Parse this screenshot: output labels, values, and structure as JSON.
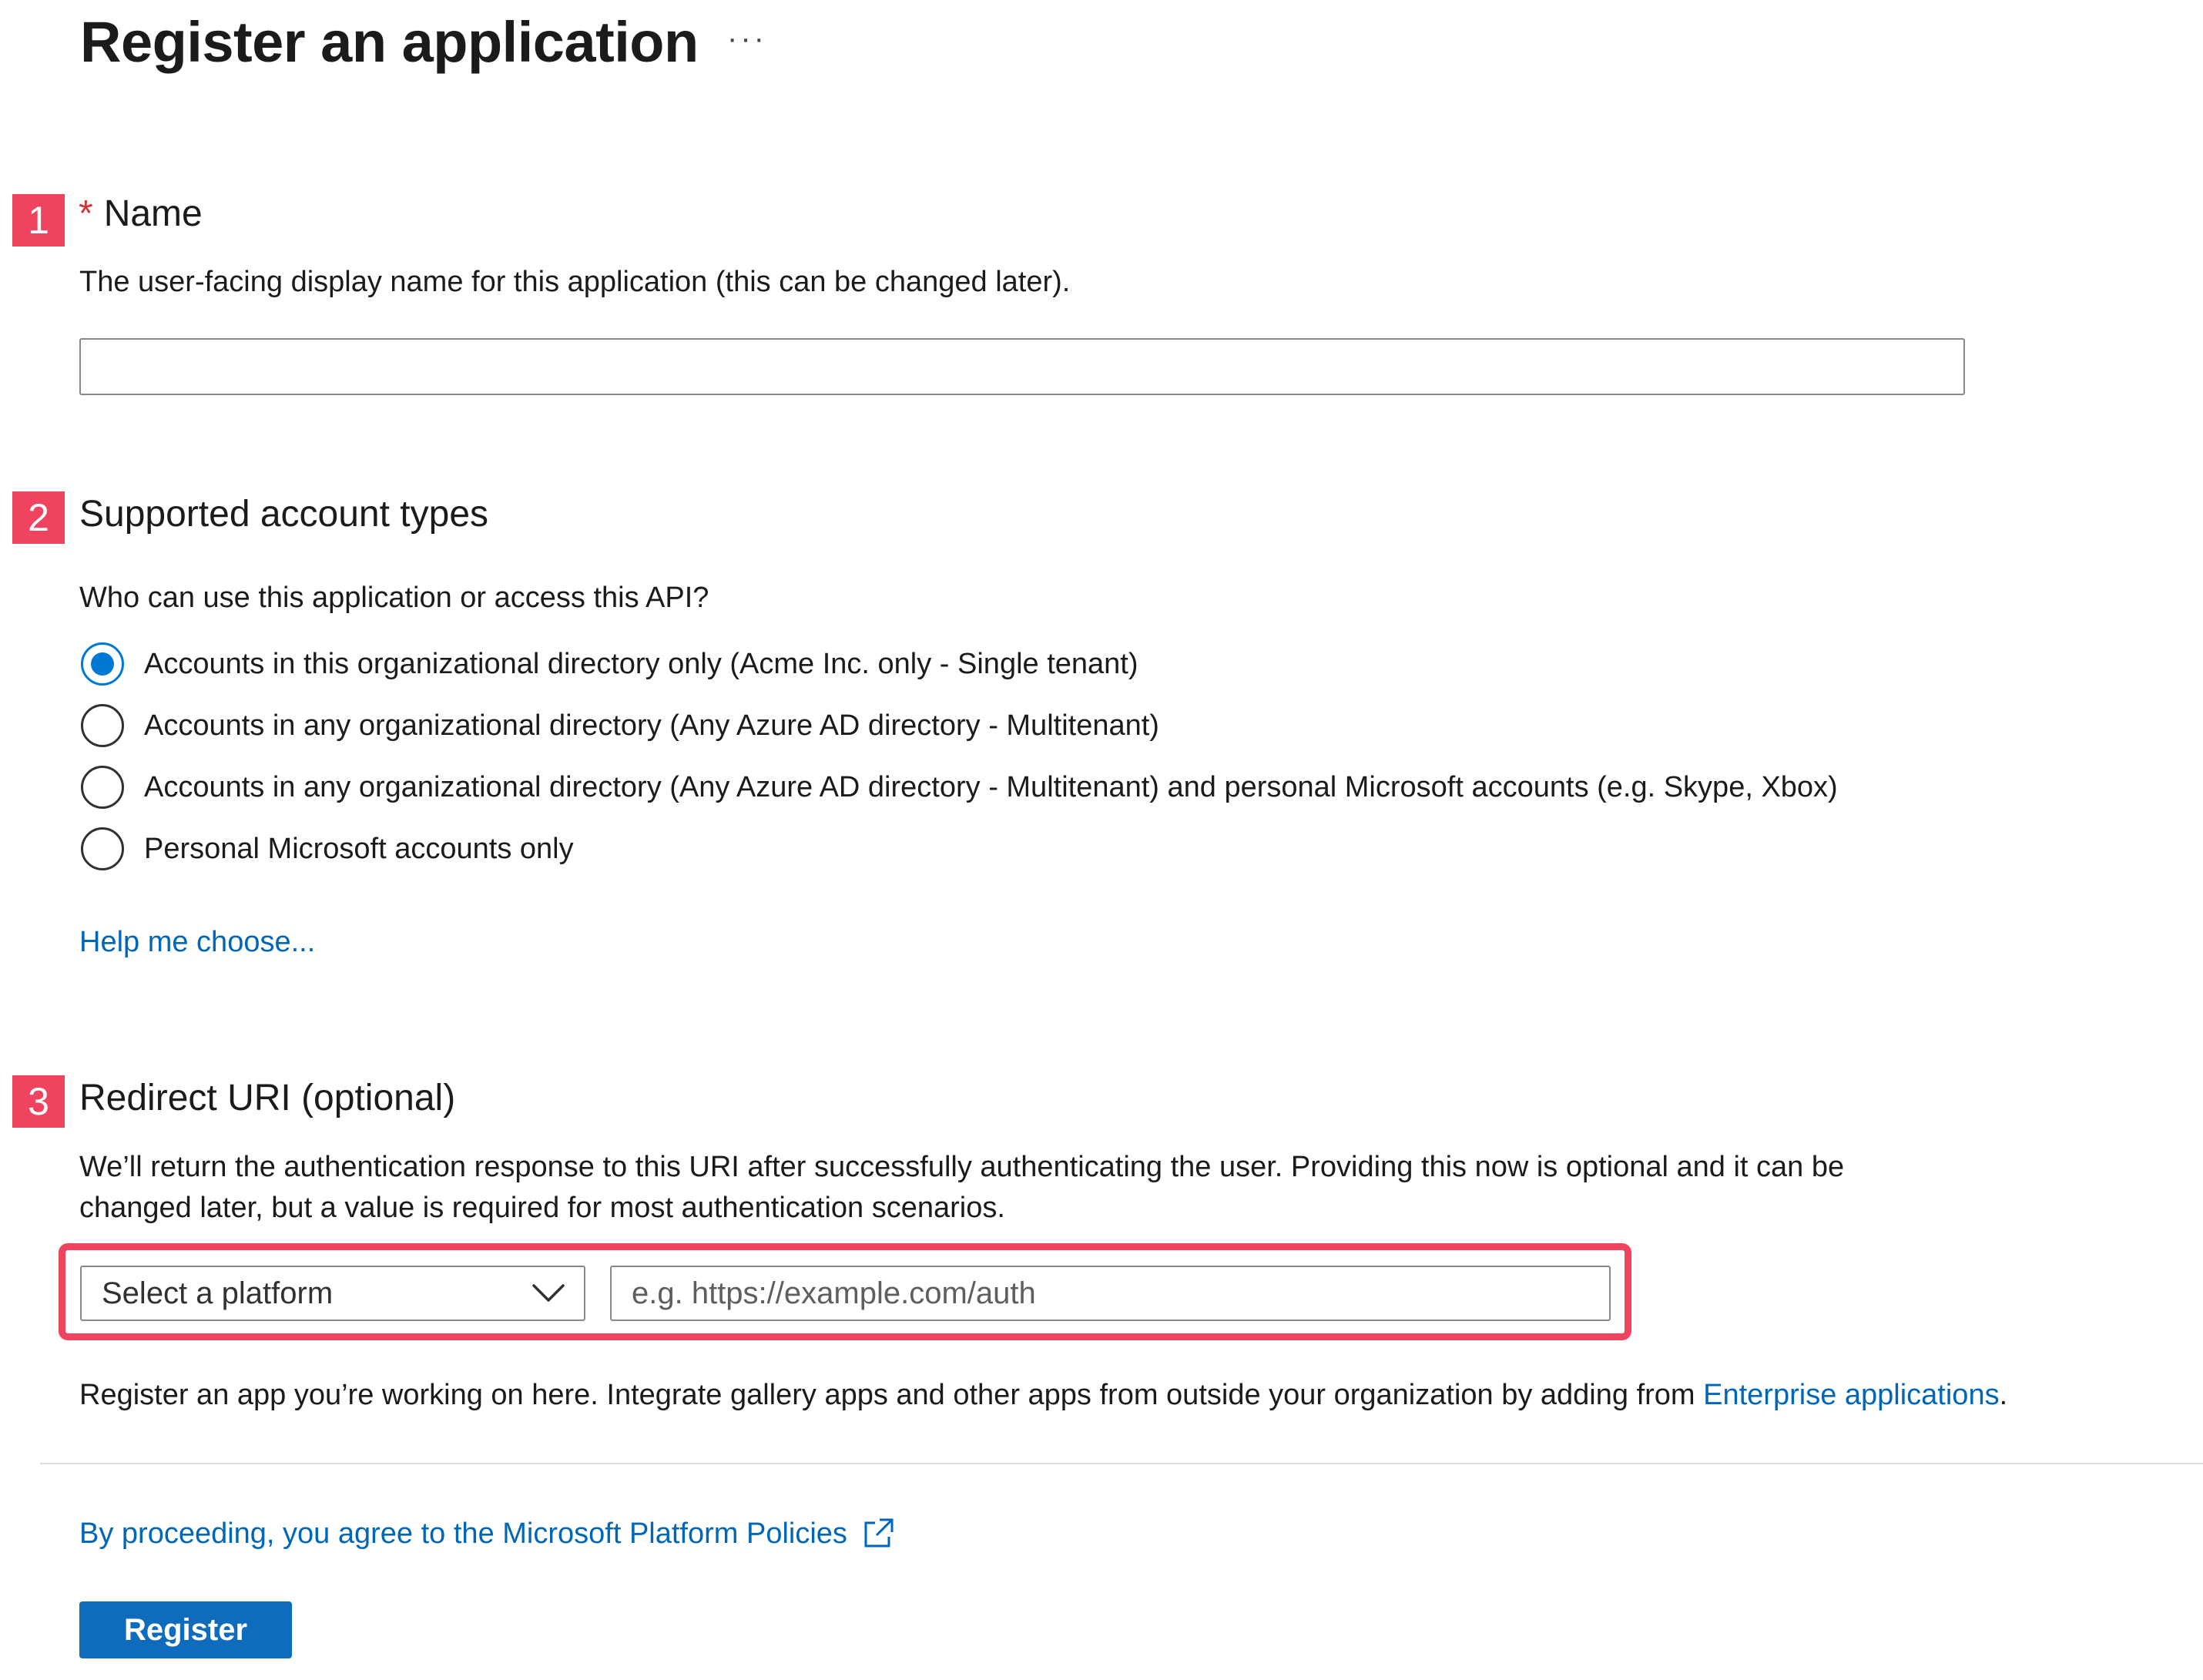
{
  "page": {
    "title": "Register an application",
    "more_label": "···"
  },
  "sections": {
    "name": {
      "badge": "1",
      "required_marker": "*",
      "title": "Name",
      "description": "The user-facing display name for this application (this can be changed later).",
      "value": "",
      "placeholder": ""
    },
    "account_types": {
      "badge": "2",
      "title": "Supported account types",
      "question": "Who can use this application or access this API?",
      "options": [
        {
          "label": "Accounts in this organizational directory only (Acme Inc. only - Single tenant)",
          "selected": true
        },
        {
          "label": "Accounts in any organizational directory (Any Azure AD directory - Multitenant)",
          "selected": false
        },
        {
          "label": "Accounts in any organizational directory (Any Azure AD directory - Multitenant) and personal Microsoft accounts (e.g. Skype, Xbox)",
          "selected": false
        },
        {
          "label": "Personal Microsoft accounts only",
          "selected": false
        }
      ],
      "help_link": "Help me choose..."
    },
    "redirect": {
      "badge": "3",
      "title": "Redirect URI (optional)",
      "description_line1": "We’ll return the authentication response to this URI after successfully authenticating the user. Providing this now is optional and it can be",
      "description_line2": "changed later, but a value is required for most authentication scenarios.",
      "platform_select": "Select a platform",
      "uri_placeholder": "e.g. https://example.com/auth"
    }
  },
  "footer": {
    "info_text": "Register an app you’re working on here. Integrate gallery apps and other apps from outside your organization by adding from ",
    "info_link": "Enterprise applications",
    "info_end": ".",
    "policies_link": "By proceeding, you agree to the Microsoft Platform Policies",
    "register_button": "Register"
  },
  "colors": {
    "badge": "#f0435f",
    "accent": "#0078d4",
    "link": "#0067b8",
    "button": "#0f6cbd"
  }
}
